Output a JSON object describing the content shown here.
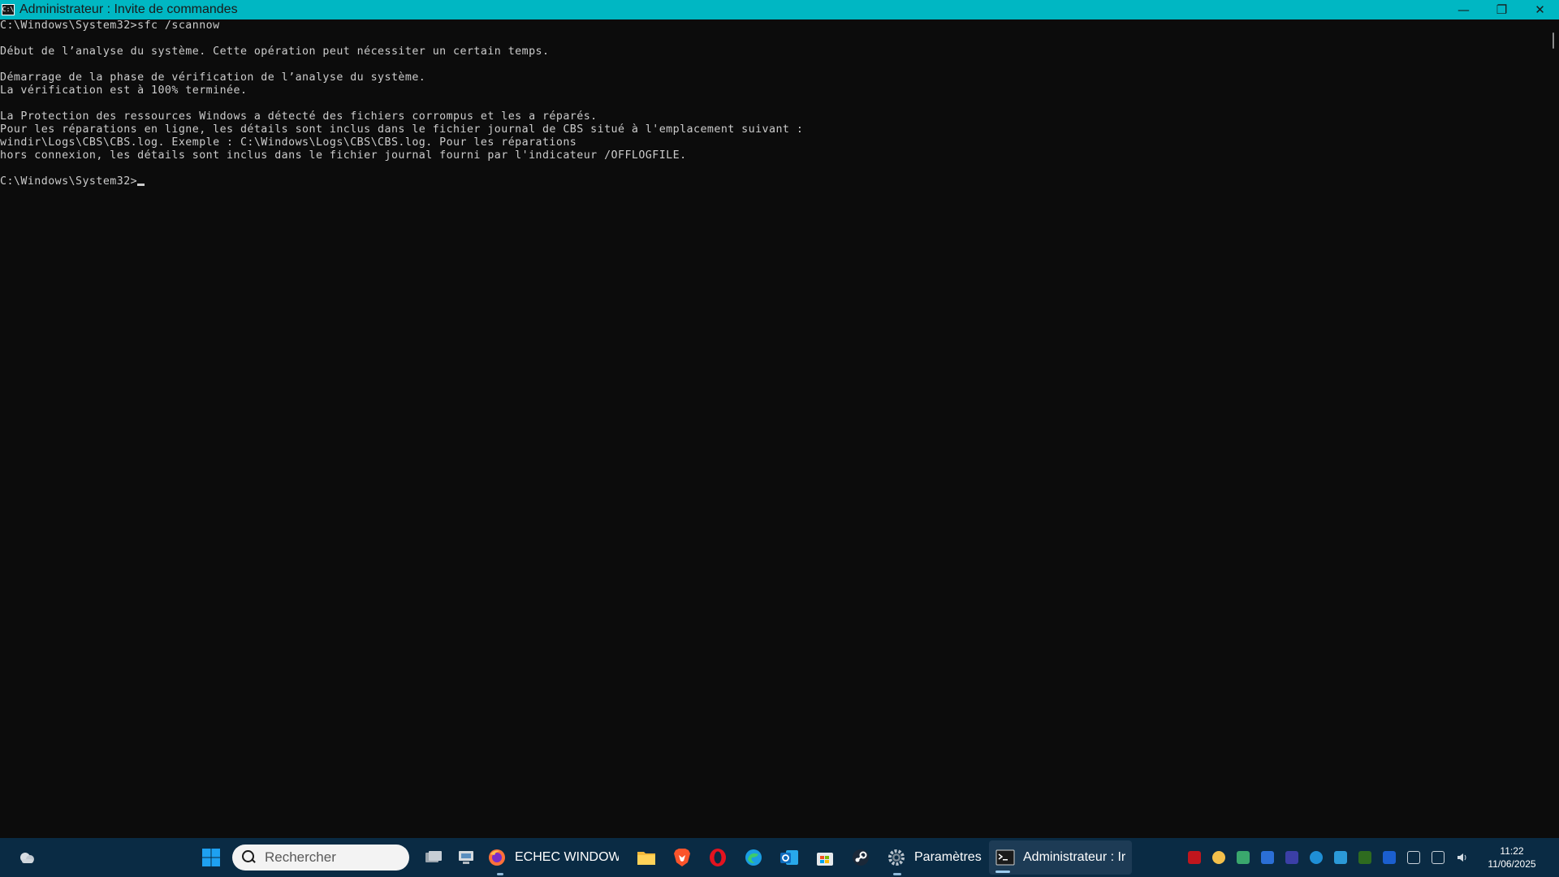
{
  "window": {
    "title": "Administrateur : Invite de commandes",
    "app_icon_text": "C:\\",
    "controls": {
      "minimize": "—",
      "restore": "❐",
      "close": "✕"
    }
  },
  "console": {
    "lines": [
      "C:\\Windows\\System32>sfc /scannow",
      "",
      "Début de l’analyse du système. Cette opération peut nécessiter un certain temps.",
      "",
      "Démarrage de la phase de vérification de l’analyse du système.",
      "La vérification est à 100% terminée.",
      "",
      "La Protection des ressources Windows a détecté des fichiers corrompus et les a réparés.",
      "Pour les réparations en ligne, les détails sont inclus dans le fichier journal de CBS situé à l'emplacement suivant :",
      "windir\\Logs\\CBS\\CBS.log. Exemple : C:\\Windows\\Logs\\CBS\\CBS.log. Pour les réparations",
      "hors connexion, les détails sont inclus dans le fichier journal fourni par l'indicateur /OFFLOGFILE.",
      "",
      "C:\\Windows\\System32>"
    ]
  },
  "taskbar": {
    "search_placeholder": "Rechercher",
    "apps": [
      {
        "name": "firefox",
        "label": "ECHEC WINDOWS"
      },
      {
        "name": "settings",
        "label": "Paramètres"
      },
      {
        "name": "cmd",
        "label": "Administrateur : Ir"
      }
    ],
    "clock": {
      "time": "11:22",
      "date": "11/06/2025"
    },
    "colors": {
      "taskbar": "#0a2b44",
      "titlebar": "#00b7c3"
    }
  }
}
